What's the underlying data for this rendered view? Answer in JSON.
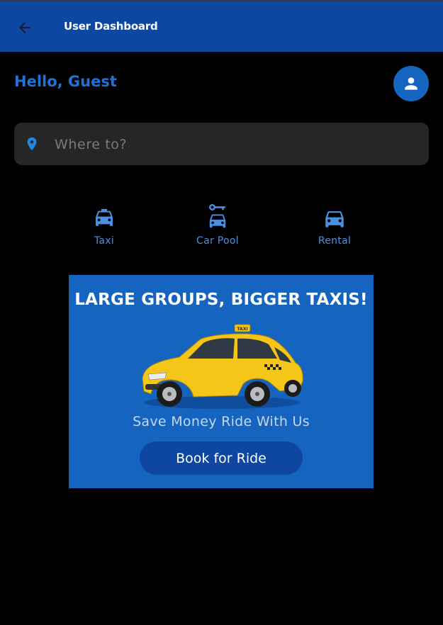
{
  "appbar": {
    "title": "User Dashboard",
    "back_icon": "arrow-back-icon",
    "background": "#0d47a1"
  },
  "greeting": "Hello, Guest",
  "profile": {
    "icon": "person-icon"
  },
  "search": {
    "placeholder": "Where to?",
    "value": "",
    "icon": "location-pin-icon"
  },
  "services": [
    {
      "label": "Taxi",
      "icon": "taxi-icon"
    },
    {
      "label": "Car Pool",
      "icon": "car-pool-icon"
    },
    {
      "label": "Rental",
      "icon": "car-rental-icon"
    }
  ],
  "promo": {
    "headline": "LARGE GROUPS, BIGGER TAXIS!",
    "image": "yellow-taxi-image",
    "tagline": "Save Money Ride With Us",
    "button_label": "Book for Ride",
    "taxi_sign_text": "TAXI"
  },
  "colors": {
    "accent": "#1e74d6",
    "banner": "#1565c0",
    "appbar": "#0d47a1",
    "background": "#000000",
    "search_bg": "#262626"
  }
}
